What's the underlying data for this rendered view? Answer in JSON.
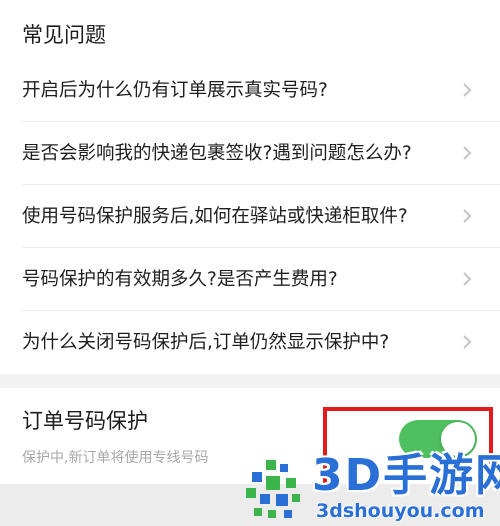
{
  "faq": {
    "title": "常见问题",
    "items": [
      {
        "question": "开启后为什么仍有订单展示真实号码?"
      },
      {
        "question": "是否会影响我的快递包裹签收?遇到问题怎么办?"
      },
      {
        "question": "使用号码保护服务后,如何在驿站或快递柜取件?"
      },
      {
        "question": "号码保护的有效期多久?是否产生费用?"
      },
      {
        "question": "为什么关闭号码保护后,订单仍然显示保护中?"
      }
    ],
    "chevron_icon": "chevron-right-icon"
  },
  "order_protection": {
    "title": "订单号码保护",
    "description": "保护中,新订单将使用专线号码",
    "toggle_state": "on",
    "toggle_color": "#4fc060"
  },
  "annotation": {
    "highlight_color": "#e11a1a"
  },
  "watermark": {
    "brand": "3D手游网",
    "url": "3dshouyou.com"
  }
}
